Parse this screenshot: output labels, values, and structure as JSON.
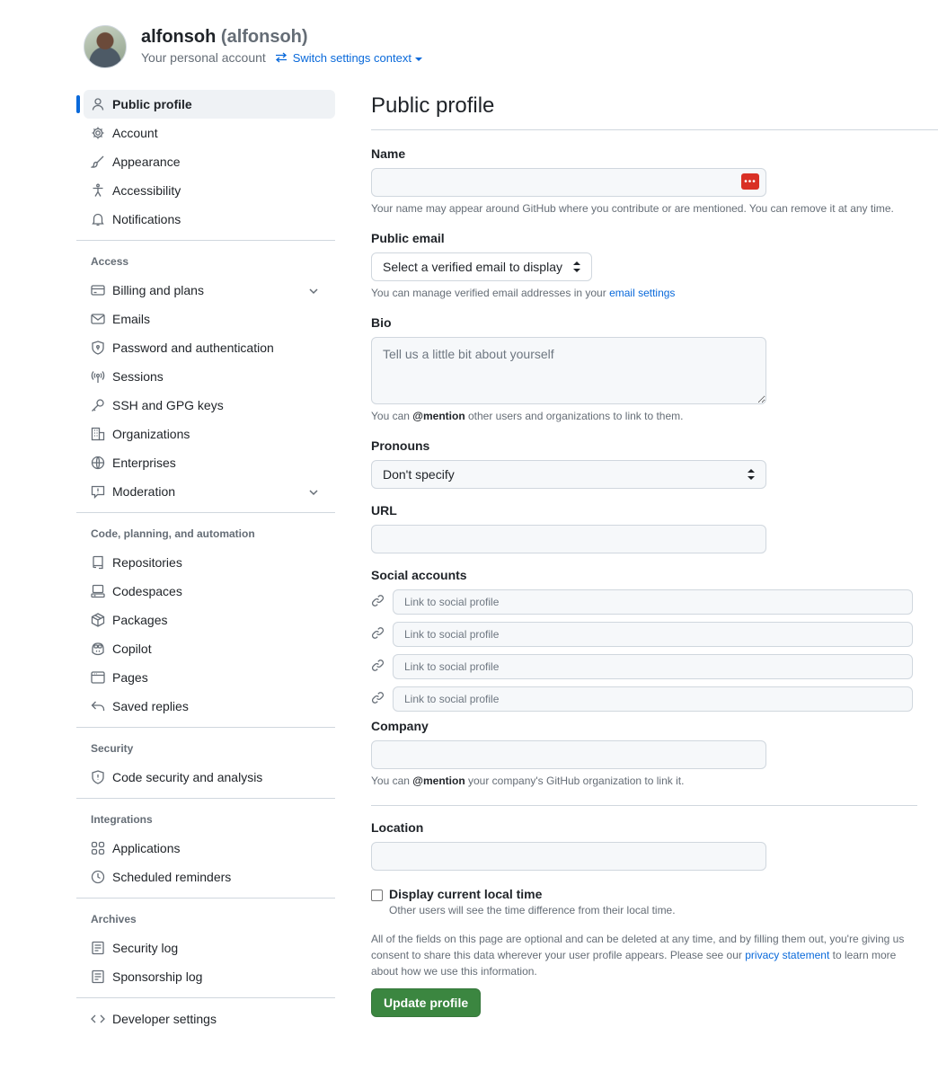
{
  "header": {
    "name": "alfonsoh",
    "handle": "(alfonsoh)",
    "subtitle": "Your personal account",
    "switch_label": "Switch settings context"
  },
  "sidebar": {
    "top_items": [
      {
        "label": "Public profile",
        "icon": "person-icon",
        "active": true
      },
      {
        "label": "Account",
        "icon": "gear-icon"
      },
      {
        "label": "Appearance",
        "icon": "paintbrush-icon"
      },
      {
        "label": "Accessibility",
        "icon": "accessibility-icon"
      },
      {
        "label": "Notifications",
        "icon": "bell-icon"
      }
    ],
    "access_title": "Access",
    "access_items": [
      {
        "label": "Billing and plans",
        "icon": "credit-card-icon",
        "expandable": true
      },
      {
        "label": "Emails",
        "icon": "mail-icon"
      },
      {
        "label": "Password and authentication",
        "icon": "shield-lock-icon"
      },
      {
        "label": "Sessions",
        "icon": "broadcast-icon"
      },
      {
        "label": "SSH and GPG keys",
        "icon": "key-icon"
      },
      {
        "label": "Organizations",
        "icon": "organization-icon"
      },
      {
        "label": "Enterprises",
        "icon": "globe-icon"
      },
      {
        "label": "Moderation",
        "icon": "report-icon",
        "expandable": true
      }
    ],
    "code_title": "Code, planning, and automation",
    "code_items": [
      {
        "label": "Repositories",
        "icon": "repo-icon"
      },
      {
        "label": "Codespaces",
        "icon": "codespaces-icon"
      },
      {
        "label": "Packages",
        "icon": "package-icon"
      },
      {
        "label": "Copilot",
        "icon": "copilot-icon"
      },
      {
        "label": "Pages",
        "icon": "browser-icon"
      },
      {
        "label": "Saved replies",
        "icon": "reply-icon"
      }
    ],
    "security_title": "Security",
    "security_items": [
      {
        "label": "Code security and analysis",
        "icon": "shield-icon"
      }
    ],
    "integrations_title": "Integrations",
    "integrations_items": [
      {
        "label": "Applications",
        "icon": "apps-icon"
      },
      {
        "label": "Scheduled reminders",
        "icon": "clock-icon"
      }
    ],
    "archives_title": "Archives",
    "archives_items": [
      {
        "label": "Security log",
        "icon": "log-icon"
      },
      {
        "label": "Sponsorship log",
        "icon": "log-icon"
      }
    ],
    "developer_label": "Developer settings"
  },
  "main": {
    "title": "Public profile",
    "name_label": "Name",
    "name_value": "",
    "name_note": "Your name may appear around GitHub where you contribute or are mentioned. You can remove it at any time.",
    "email_label": "Public email",
    "email_select": "Select a verified email to display",
    "email_note_prefix": "You can manage verified email addresses in your",
    "email_note_link": "email settings",
    "bio_label": "Bio",
    "bio_placeholder": "Tell us a little bit about yourself",
    "bio_note_pre": "You can",
    "bio_note_mention": "@mention",
    "bio_note_post": "other users and organizations to link to them.",
    "pronouns_label": "Pronouns",
    "pronouns_value": "Don't specify",
    "url_label": "URL",
    "url_value": "",
    "social_label": "Social accounts",
    "social_placeholder": "Link to social profile",
    "company_label": "Company",
    "company_note_pre": "You can",
    "company_note_mention": "@mention",
    "company_note_post": "your company's GitHub organization to link it.",
    "location_label": "Location",
    "local_time_label": "Display current local time",
    "local_time_note": "Other users will see the time difference from their local time.",
    "legal_text": "All of the fields on this page are optional and can be deleted at any time, and by filling them out, you're giving us consent to share this data wherever your user profile appears. Please see our",
    "legal_link": "privacy statement",
    "legal_tail": "to learn more about how we use this information.",
    "submit_label": "Update profile"
  },
  "colors": {
    "accent": "#0969da",
    "button": "#3b8640",
    "badge": "#d93025"
  }
}
